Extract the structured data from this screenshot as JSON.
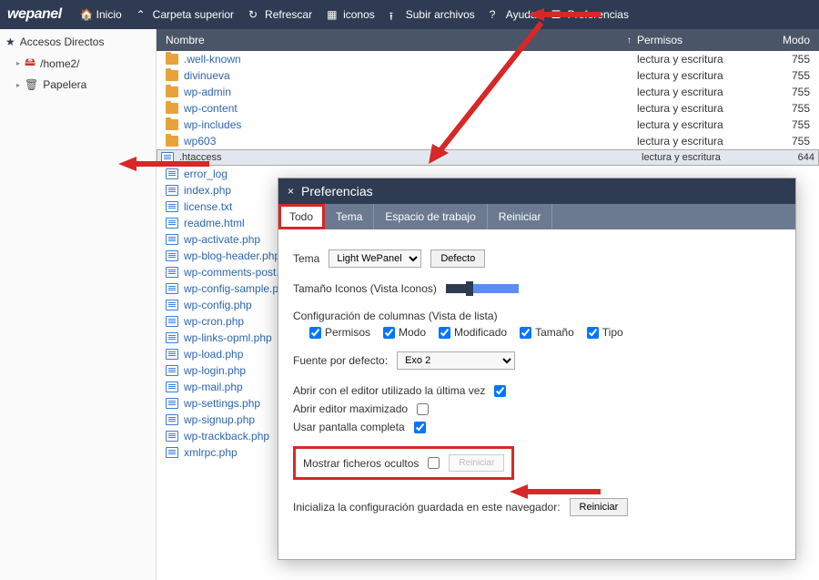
{
  "brand": "wepanel",
  "toolbar": {
    "home": "Inicio",
    "parent": "Carpeta superior",
    "refresh": "Refrescar",
    "icons": "iconos",
    "upload": "Subir archivos",
    "help": "Ayuda",
    "prefs": "Preferencias"
  },
  "sidebar": {
    "shortcuts": "Accesos Directos",
    "home": "/home2/",
    "trash": "Papelera"
  },
  "columns": {
    "name": "Nombre",
    "perm": "Permisos",
    "mode": "Modo"
  },
  "perm_text": "lectura y escritura",
  "files": [
    {
      "n": ".well-known",
      "t": "d",
      "m": "755"
    },
    {
      "n": "divinueva",
      "t": "d",
      "m": "755"
    },
    {
      "n": "wp-admin",
      "t": "d",
      "m": "755"
    },
    {
      "n": "wp-content",
      "t": "d",
      "m": "755"
    },
    {
      "n": "wp-includes",
      "t": "d",
      "m": "755"
    },
    {
      "n": "wp603",
      "t": "d",
      "m": "755"
    },
    {
      "n": ".htaccess",
      "t": "f",
      "m": "644",
      "sel": true
    },
    {
      "n": "error_log",
      "t": "f"
    },
    {
      "n": "index.php",
      "t": "f"
    },
    {
      "n": "license.txt",
      "t": "f"
    },
    {
      "n": "readme.html",
      "t": "f"
    },
    {
      "n": "wp-activate.php",
      "t": "f"
    },
    {
      "n": "wp-blog-header.php",
      "t": "f"
    },
    {
      "n": "wp-comments-post.php",
      "t": "f"
    },
    {
      "n": "wp-config-sample.php",
      "t": "f"
    },
    {
      "n": "wp-config.php",
      "t": "f"
    },
    {
      "n": "wp-cron.php",
      "t": "f"
    },
    {
      "n": "wp-links-opml.php",
      "t": "f"
    },
    {
      "n": "wp-load.php",
      "t": "f"
    },
    {
      "n": "wp-login.php",
      "t": "f"
    },
    {
      "n": "wp-mail.php",
      "t": "f"
    },
    {
      "n": "wp-settings.php",
      "t": "f"
    },
    {
      "n": "wp-signup.php",
      "t": "f"
    },
    {
      "n": "wp-trackback.php",
      "t": "f"
    },
    {
      "n": "xmlrpc.php",
      "t": "f"
    }
  ],
  "dialog": {
    "title": "Preferencias",
    "tabs": [
      "Todo",
      "Tema",
      "Espacio de trabajo",
      "Reiniciar"
    ],
    "theme_label": "Tema",
    "theme_value": "Light WePanel",
    "default_btn": "Defecto",
    "icon_size": "Tamaño Iconos (Vista Iconos)",
    "col_config": "Configuración de columnas (Vista de lista)",
    "col_perm": "Permisos",
    "col_mode": "Modo",
    "col_mod": "Modificado",
    "col_size": "Tamaño",
    "col_type": "Tipo",
    "default_font": "Fuente por defecto:",
    "font_value": "Exo 2",
    "open_last": "Abrir con el editor utilizado la última vez",
    "open_max": "Abrir editor maximizado",
    "fullscreen": "Usar pantalla completa",
    "show_hidden": "Mostrar ficheros ocultos",
    "reset_small": "Reiniciar",
    "reset_label": "Inicializa la configuración guardada en este navegador:",
    "reset_btn": "Reiniciar"
  }
}
